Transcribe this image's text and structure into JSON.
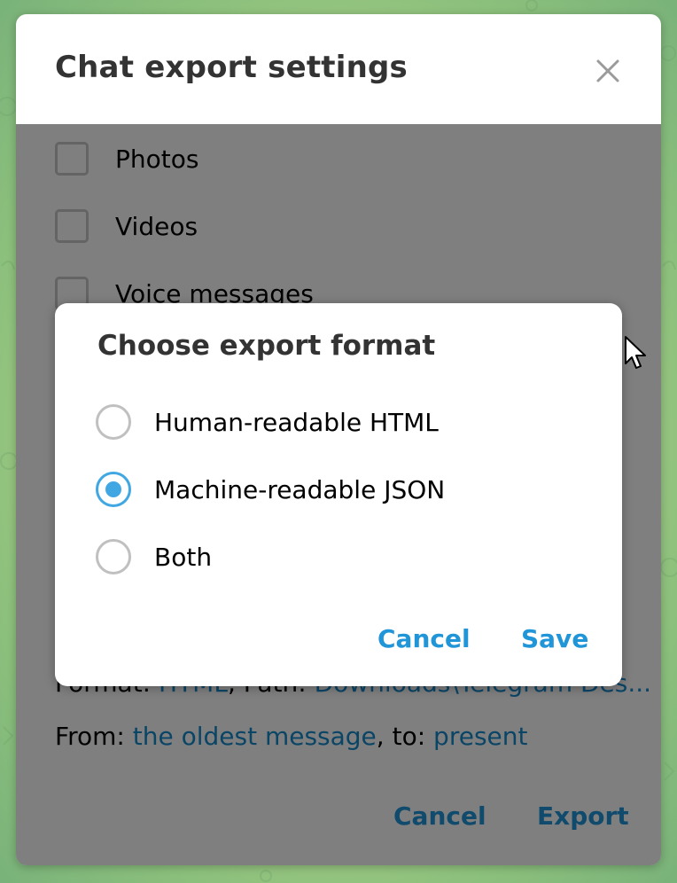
{
  "dialog": {
    "title": "Chat export settings",
    "checkboxes": [
      {
        "label": "Photos",
        "checked": false
      },
      {
        "label": "Videos",
        "checked": false
      },
      {
        "label": "Voice messages",
        "checked": false
      }
    ],
    "format_line": {
      "prefix": "Format: ",
      "format_value": "HTML",
      "path_prefix": ", Path: ",
      "path_value": "Downloads\\Telegram Des..."
    },
    "range_line": {
      "from_prefix": "From: ",
      "from_value": "the oldest message",
      "to_prefix": ", to: ",
      "to_value": "present"
    },
    "cancel_label": "Cancel",
    "export_label": "Export"
  },
  "popup": {
    "title": "Choose export format",
    "options": [
      {
        "label": "Human-readable HTML",
        "selected": false
      },
      {
        "label": "Machine-readable JSON",
        "selected": true
      },
      {
        "label": "Both",
        "selected": false
      }
    ],
    "cancel_label": "Cancel",
    "save_label": "Save"
  },
  "colors": {
    "accent": "#40a7e3",
    "link": "#168acd",
    "overlay": "rgba(0,0,0,0.5)"
  },
  "icons": {
    "close": "close-icon",
    "cursor": "mouse-pointer-icon"
  }
}
